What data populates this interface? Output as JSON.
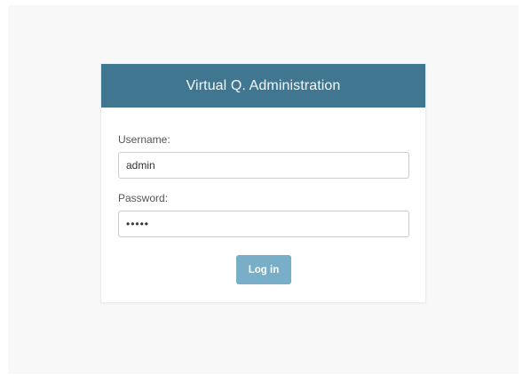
{
  "header": {
    "title": "Virtual Q. Administration"
  },
  "form": {
    "username_label": "Username:",
    "username_value": "admin",
    "password_label": "Password:",
    "password_value": "admin",
    "login_label": "Log in"
  },
  "colors": {
    "header_bg": "#417690",
    "button_bg": "#79aec8",
    "page_bg": "#f8f8f8"
  }
}
